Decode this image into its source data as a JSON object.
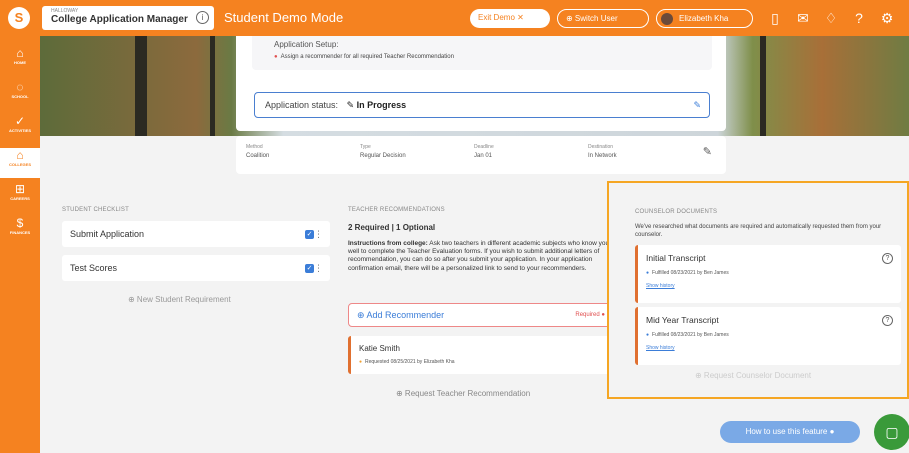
{
  "topbar": {
    "app_small": "HALLOWAY",
    "app_name": "College Application Manager",
    "demo_mode": "Student Demo Mode",
    "exit_demo": "Exit Demo ✕",
    "switch_user": "⊕ Switch User",
    "user_name": "Elizabeth Kha"
  },
  "sidebar": {
    "items": [
      {
        "label": "HOME",
        "icon": "⌂"
      },
      {
        "label": "SCHOOL",
        "icon": "◌"
      },
      {
        "label": "ACTIVITIES",
        "icon": "✓"
      },
      {
        "label": "COLLEGES",
        "icon": "⌂"
      },
      {
        "label": "CAREERS",
        "icon": "⊞"
      },
      {
        "label": "FINANCES",
        "icon": "$"
      }
    ]
  },
  "application": {
    "setup_label": "Application Setup:",
    "warning": "Assign a recommender for all required Teacher Recommendation",
    "status_label": "Application status:",
    "status_value": "✎ In Progress",
    "meta": [
      {
        "head": "Method",
        "value": "Coalition"
      },
      {
        "head": "Type",
        "value": "Regular Decision"
      },
      {
        "head": "Deadline",
        "value": "Jan 01"
      },
      {
        "head": "Destination",
        "value": "In Network"
      }
    ]
  },
  "checklist": {
    "title": "STUDENT CHECKLIST",
    "items": [
      "Submit Application",
      "Test Scores"
    ],
    "new_req": "⊕ New Student Requirement"
  },
  "teacher": {
    "title": "TEACHER RECOMMENDATIONS",
    "sub": "2 Required | 1 Optional",
    "instr_bold": "Instructions from college:",
    "instr": " Ask two teachers in different academic subjects who know you well to complete the Teacher Evaluation forms. If you wish to submit additional letters of recommendation, you can do so after you submit your application. In your application confirmation email, there will be a personalized link to send to your recommenders.",
    "add": "⊕ Add Recommender",
    "required": "Required ●",
    "rec_name": "Katie Smith",
    "rec_status": "Requested 08/25/2021 by Elizabeth Kha",
    "request": "⊕ Request Teacher Recommendation"
  },
  "counselor": {
    "title": "COUNSELOR DOCUMENTS",
    "desc": "We've researched what documents are required and automatically requested them from your counselor.",
    "docs": [
      {
        "name": "Initial Transcript",
        "status": "Fulfilled 08/23/2021 by Ben James",
        "history": "Show history"
      },
      {
        "name": "Mid Year Transcript",
        "status": "Fulfilled 08/23/2021 by Ben James",
        "history": "Show history"
      }
    ],
    "request": "⊕ Request Counselor Document"
  },
  "help": {
    "howto": "How to use this feature ●"
  }
}
